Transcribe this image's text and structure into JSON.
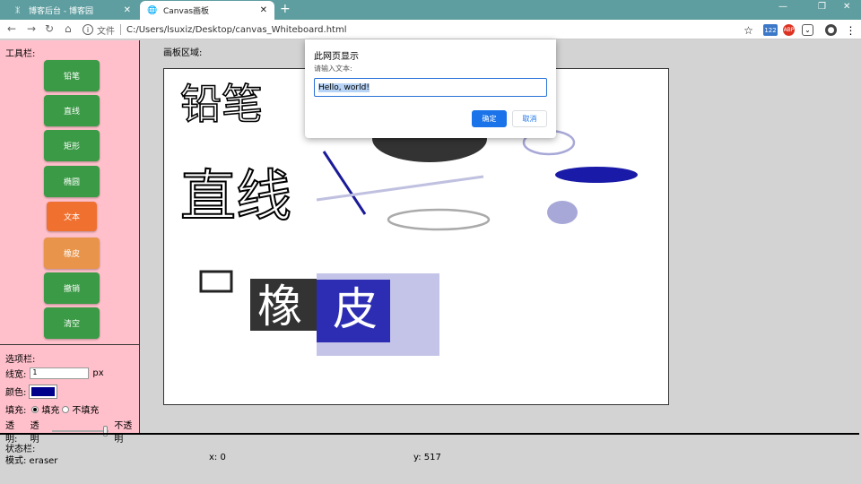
{
  "browser": {
    "tabs": [
      {
        "label": "博客后台 - 博客园"
      },
      {
        "label": "Canvas画板"
      }
    ],
    "address": {
      "scheme": "文件",
      "path": "C:/Users/lsuxiz/Desktop/canvas_Whiteboard.html"
    },
    "badge_count": "122"
  },
  "sidebar": {
    "tools_title": "工具栏:",
    "tools": [
      "铅笔",
      "直线",
      "矩形",
      "椭圆",
      "文本",
      "橡皮",
      "撤销",
      "清空"
    ],
    "options_title": "选项栏:",
    "line_width_label": "线宽:",
    "line_width_value": "1",
    "line_width_unit": "px",
    "color_label": "颜色:",
    "color_value": "#00008b",
    "fill_label": "填充:",
    "fill_on": "填充",
    "fill_off": "不填充",
    "opacity_label": "透明:",
    "opacity_min": "透明",
    "opacity_max": "不透明",
    "opacity_level": 0.9
  },
  "canvas": {
    "title": "画板区域:",
    "text_pencil": "铅笔",
    "text_line": "直线",
    "text_eraser_1": "橡",
    "text_eraser_2": "皮"
  },
  "status": {
    "title": "状态栏:",
    "mode": "模式: eraser",
    "x": "x:  0",
    "y": "y:  517"
  },
  "dialog": {
    "title": "此网页显示",
    "prompt": "请输入文本:",
    "value": "Hello, world!",
    "ok": "确定",
    "cancel": "取消"
  }
}
